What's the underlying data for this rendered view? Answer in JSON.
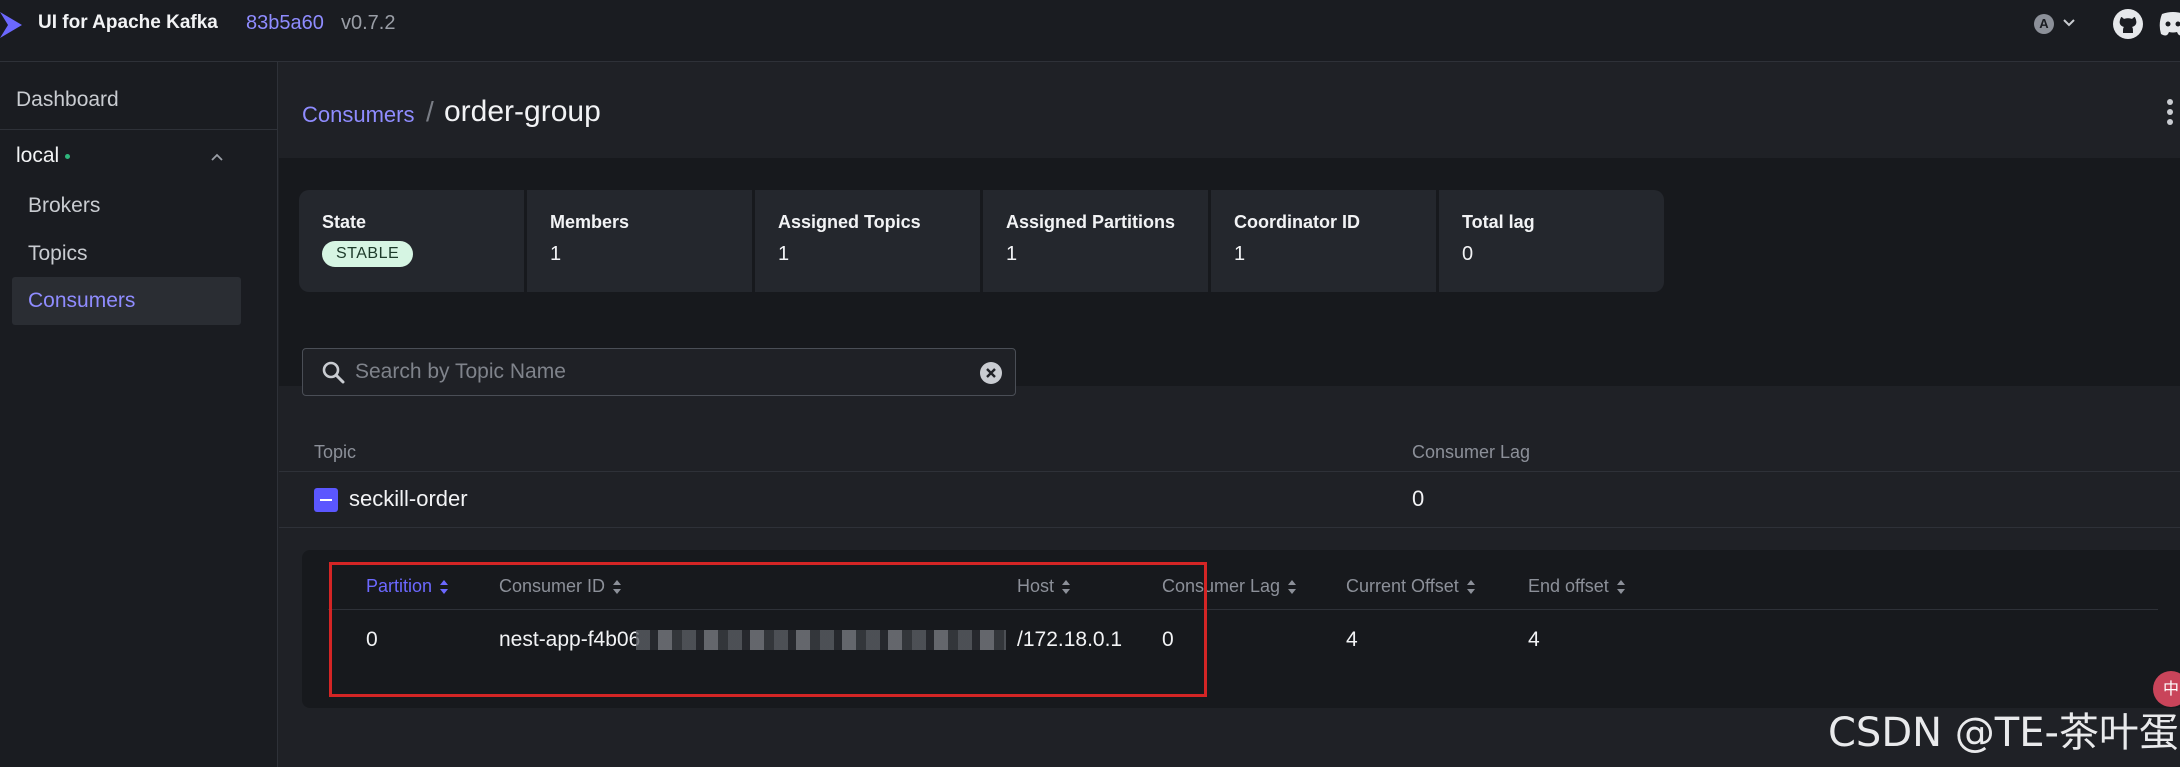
{
  "app": {
    "title": "UI for Apache Kafka",
    "commit": "83b5a60",
    "version": "v0.7.2",
    "theme_letter": "A"
  },
  "sidebar": {
    "dashboard": "Dashboard",
    "cluster": "local",
    "items": [
      {
        "label": "Brokers"
      },
      {
        "label": "Topics"
      },
      {
        "label": "Consumers"
      }
    ]
  },
  "breadcrumb": {
    "parent": "Consumers",
    "separator": "/",
    "current": "order-group"
  },
  "stats": {
    "state": {
      "label": "State",
      "value": "STABLE"
    },
    "members": {
      "label": "Members",
      "value": "1"
    },
    "assigned_topics": {
      "label": "Assigned Topics",
      "value": "1"
    },
    "assigned_partitions": {
      "label": "Assigned Partitions",
      "value": "1"
    },
    "coordinator_id": {
      "label": "Coordinator ID",
      "value": "1"
    },
    "total_lag": {
      "label": "Total lag",
      "value": "0"
    }
  },
  "search": {
    "placeholder": "Search by Topic Name",
    "value": ""
  },
  "topics_table": {
    "columns": [
      "Topic",
      "Consumer Lag"
    ],
    "rows": [
      {
        "topic": "seckill-order",
        "lag": "0"
      }
    ]
  },
  "partitions_table": {
    "columns": [
      "Partition",
      "Consumer ID",
      "Host",
      "Consumer Lag",
      "Current Offset",
      "End offset"
    ],
    "rows": [
      {
        "partition": "0",
        "consumer_id": "nest-app-f4b06",
        "host": "/172.18.0.1",
        "lag": "0",
        "current_offset": "4",
        "end_offset": "4"
      }
    ]
  },
  "overlay": {
    "watermark": "CSDN @TE-茶叶蛋",
    "float_badge": "中"
  },
  "colors": {
    "accent": "#8f8cff",
    "background": "#1f2126",
    "panel": "#17191d",
    "badge_stable_bg": "#d6f5e3",
    "highlight": "#d42525"
  }
}
